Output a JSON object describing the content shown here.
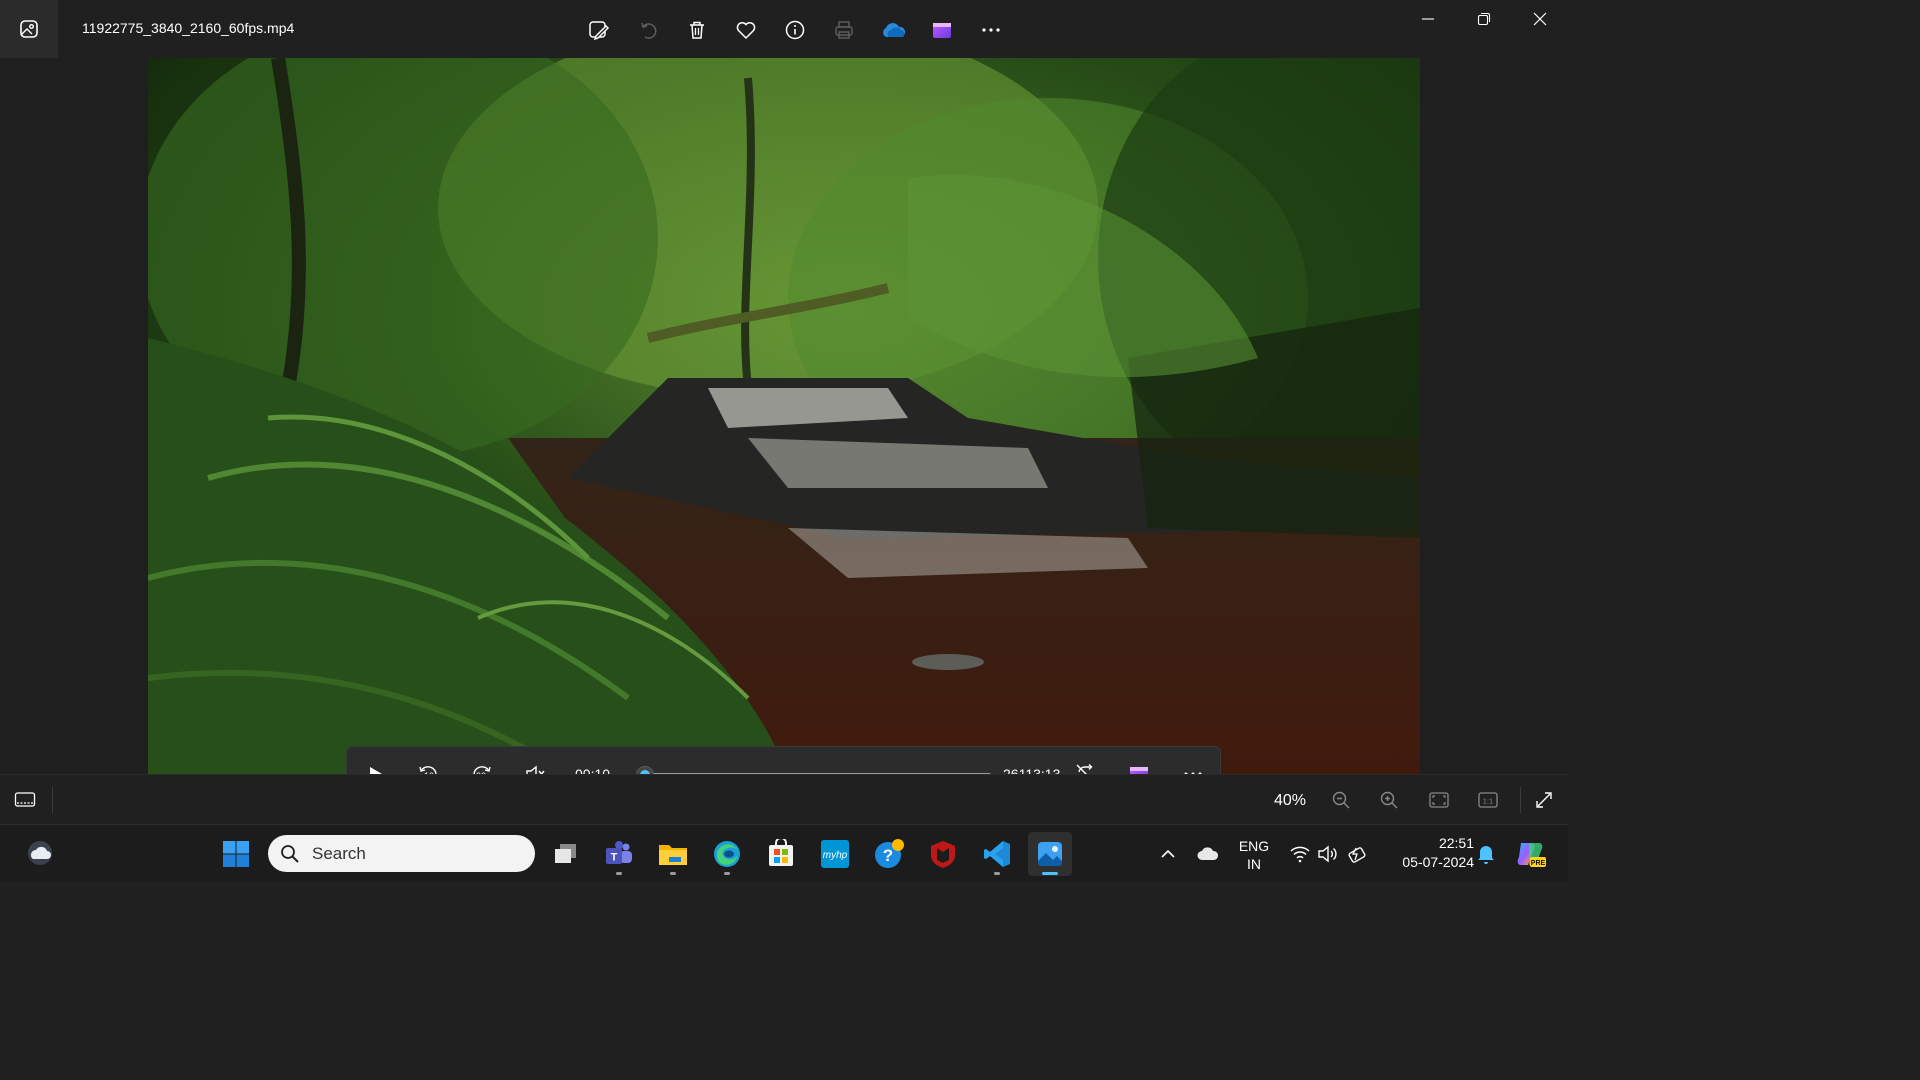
{
  "titlebar": {
    "file_name": "11922775_3840_2160_60fps.mp4",
    "toolbar_icons": [
      "edit-icon",
      "rotate-icon",
      "delete-icon",
      "favorite-icon",
      "info-icon",
      "print-icon",
      "onedrive-icon",
      "clipchamp-icon",
      "more-icon"
    ]
  },
  "player": {
    "current_time": "00:10",
    "duration": "26113:13",
    "progress_fraction": 0.006,
    "accent": "#4cc2ff",
    "skip_back": "10",
    "skip_forward": "30"
  },
  "statusbar": {
    "zoom": "40%",
    "actual_size_label": "1:1"
  },
  "taskbar": {
    "search_placeholder": "Search",
    "lang_top": "ENG",
    "lang_bottom": "IN",
    "time": "22:51",
    "date": "05-07-2024",
    "myhp_label": "myhp",
    "copilot_badge": "PRE"
  }
}
